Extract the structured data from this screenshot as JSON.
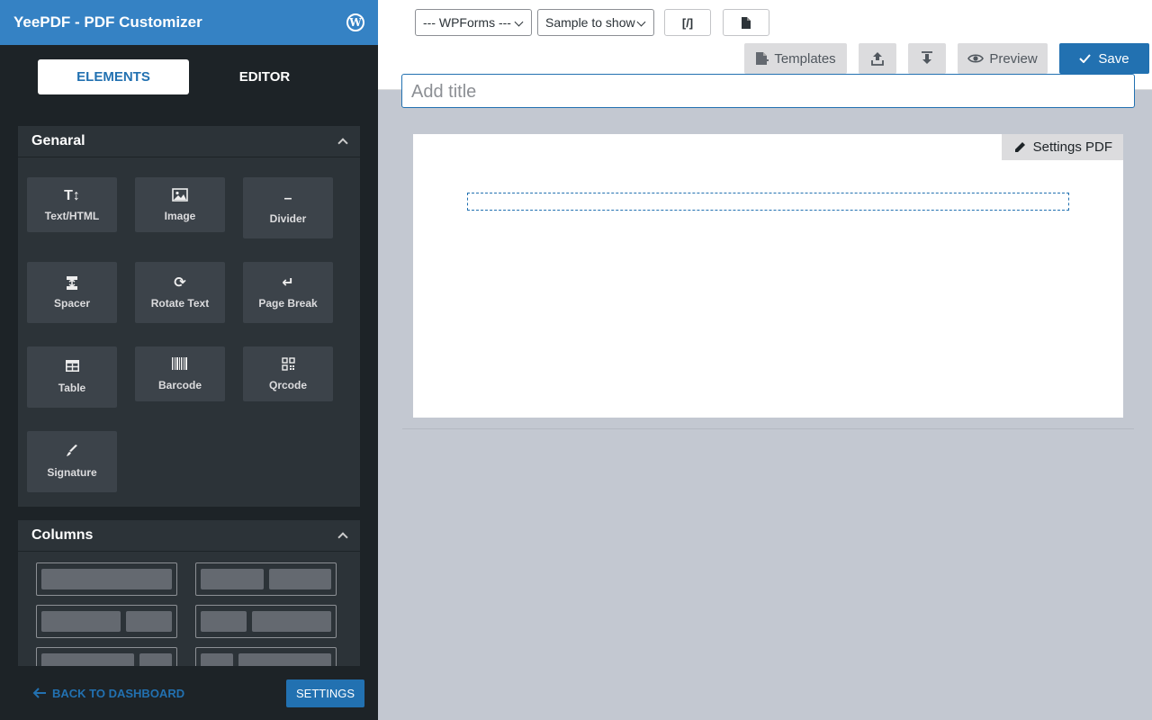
{
  "sidebar": {
    "title": "YeePDF - PDF Customizer",
    "tabs": [
      {
        "label": "ELEMENTS",
        "active": true
      },
      {
        "label": "EDITOR",
        "active": false
      }
    ],
    "general": {
      "heading": "Genaral",
      "items": [
        {
          "label": "Text/HTML",
          "icon": "text-html-icon"
        },
        {
          "label": "Image",
          "icon": "image-icon"
        },
        {
          "label": "Divider",
          "icon": "divider-icon"
        },
        {
          "label": "Spacer",
          "icon": "spacer-icon"
        },
        {
          "label": "Rotate Text",
          "icon": "rotate-icon"
        },
        {
          "label": "Page Break",
          "icon": "page-break-icon"
        },
        {
          "label": "Table",
          "icon": "table-icon"
        },
        {
          "label": "Barcode",
          "icon": "barcode-icon"
        },
        {
          "label": "Qrcode",
          "icon": "qrcode-icon"
        },
        {
          "label": "Signature",
          "icon": "signature-icon"
        }
      ]
    },
    "columns": {
      "heading": "Columns"
    },
    "footer": {
      "back_label": "BACK TO DASHBOARD",
      "settings_label": "SETTINGS"
    }
  },
  "toolbar": {
    "form_select": "--- WPForms ---",
    "sample_select": "Sample to show",
    "shortcode_label": "[/]",
    "templates_label": "Templates",
    "preview_label": "Preview",
    "save_label": "Save"
  },
  "editor": {
    "title_placeholder": "Add title",
    "settings_pdf_label": "Settings PDF"
  },
  "colors": {
    "accent": "#2271b1",
    "header": "#3582c4",
    "sidebar": "#1d2327",
    "workspace": "#c3c8d1"
  }
}
